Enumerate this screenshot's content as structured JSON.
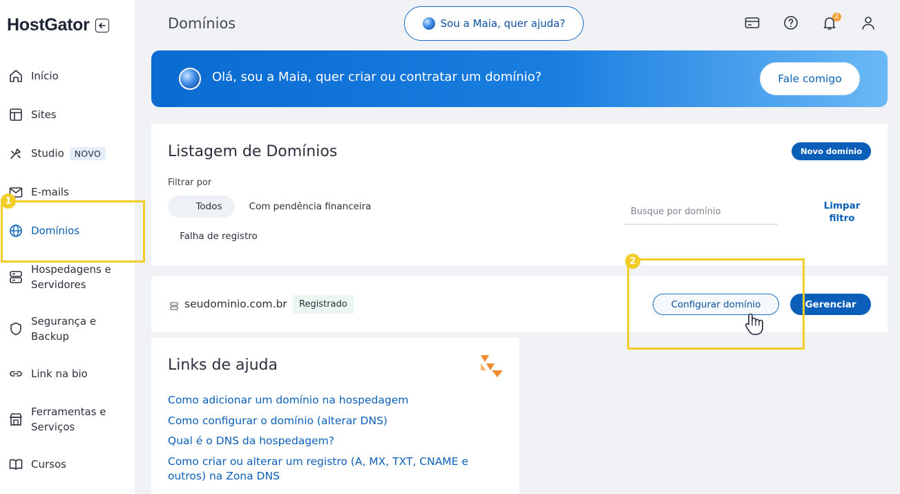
{
  "brand": {
    "logo": "HostGator"
  },
  "sidebar": {
    "items": [
      {
        "label": "Início",
        "icon": "home-icon"
      },
      {
        "label": "Sites",
        "icon": "layout-icon"
      },
      {
        "label": "Studio",
        "icon": "studio-icon",
        "badge": "NOVO"
      },
      {
        "label": "E-mails",
        "icon": "mail-icon"
      },
      {
        "label": "Domínios",
        "icon": "globe-icon",
        "active": true
      },
      {
        "label": "Hospedagens e Servidores",
        "icon": "server-icon"
      },
      {
        "label": "Segurança e Backup",
        "icon": "shield-icon"
      },
      {
        "label": "Link na bio",
        "icon": "link-icon"
      },
      {
        "label": "Ferramentas e Serviços",
        "icon": "tools-icon"
      },
      {
        "label": "Cursos",
        "icon": "book-icon"
      }
    ]
  },
  "header": {
    "title": "Domínios",
    "maia_button": "Sou a Maia, quer ajuda?",
    "notification_count": "2"
  },
  "banner": {
    "text": "Olá, sou a Maia, quer criar ou contratar um domínio?",
    "button": "Fale comigo"
  },
  "listing": {
    "title": "Listagem de Domínios",
    "new_domain_button": "Novo domínio",
    "filter_label": "Filtrar por",
    "filters": [
      "Todos",
      "Com pendência financeira",
      "Falha de registro"
    ],
    "search_placeholder": "Busque por domínio",
    "clear_filter": "Limpar filtro"
  },
  "domain_row": {
    "name": "seudominio.com.br",
    "status": "Registrado",
    "configure_button": "Configurar domínio",
    "manage_button": "Gerenciar"
  },
  "help": {
    "title": "Links de ajuda",
    "links": [
      "Como adicionar um domínio na hospedagem",
      "Como configurar o domínio (alterar DNS)",
      "Qual é o DNS da hospedagem?",
      "Como criar ou alterar um registro (A, MX, TXT, CNAME e outros) na Zona DNS"
    ]
  },
  "annotations": {
    "step1": "1",
    "step2": "2"
  },
  "colors": {
    "primary": "#0b5fb8",
    "highlight": "#f2cd27",
    "accent": "#f2a33a"
  }
}
